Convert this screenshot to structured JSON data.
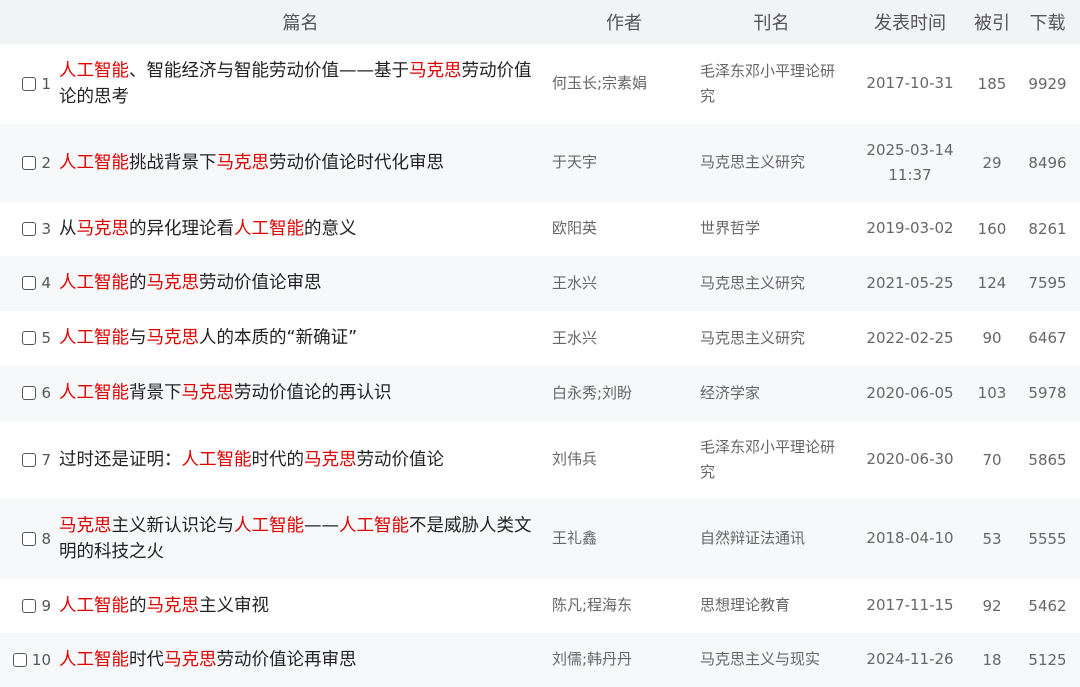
{
  "header": {
    "title": "篇名",
    "author": "作者",
    "journal": "刊名",
    "date": "发表时间",
    "cited": "被引",
    "downloads": "下载"
  },
  "rows": [
    {
      "index": "1",
      "title_parts": [
        [
          "hl",
          "人工智能"
        ],
        [
          "n",
          "、智能经济与智能劳动价值——基于"
        ],
        [
          "hl",
          "马克思"
        ],
        [
          "n",
          "劳动价值论的思考"
        ]
      ],
      "authors": "何玉长;宗素娟",
      "journal": "毛泽东邓小平理论研究",
      "date": "2017-10-31",
      "cited": "185",
      "downloads": "9929"
    },
    {
      "index": "2",
      "title_parts": [
        [
          "hl",
          "人工智能"
        ],
        [
          "n",
          "挑战背景下"
        ],
        [
          "hl",
          "马克思"
        ],
        [
          "n",
          "劳动价值论时代化审思"
        ]
      ],
      "authors": "于天宇",
      "journal": "马克思主义研究",
      "date": "2025-03-14 11:37",
      "cited": "29",
      "downloads": "8496"
    },
    {
      "index": "3",
      "title_parts": [
        [
          "n",
          "从"
        ],
        [
          "hl",
          "马克思"
        ],
        [
          "n",
          "的异化理论看"
        ],
        [
          "hl",
          "人工智能"
        ],
        [
          "n",
          "的意义"
        ]
      ],
      "authors": "欧阳英",
      "journal": "世界哲学",
      "date": "2019-03-02",
      "cited": "160",
      "downloads": "8261"
    },
    {
      "index": "4",
      "title_parts": [
        [
          "hl",
          "人工智能"
        ],
        [
          "n",
          "的"
        ],
        [
          "hl",
          "马克思"
        ],
        [
          "n",
          "劳动价值论审思"
        ]
      ],
      "authors": "王水兴",
      "journal": "马克思主义研究",
      "date": "2021-05-25",
      "cited": "124",
      "downloads": "7595"
    },
    {
      "index": "5",
      "title_parts": [
        [
          "hl",
          "人工智能"
        ],
        [
          "n",
          "与"
        ],
        [
          "hl",
          "马克思"
        ],
        [
          "n",
          "人的本质的“新确证”"
        ]
      ],
      "authors": "王水兴",
      "journal": "马克思主义研究",
      "date": "2022-02-25",
      "cited": "90",
      "downloads": "6467"
    },
    {
      "index": "6",
      "title_parts": [
        [
          "hl",
          "人工智能"
        ],
        [
          "n",
          "背景下"
        ],
        [
          "hl",
          "马克思"
        ],
        [
          "n",
          "劳动价值论的再认识"
        ]
      ],
      "authors": "白永秀;刘盼",
      "journal": "经济学家",
      "date": "2020-06-05",
      "cited": "103",
      "downloads": "5978"
    },
    {
      "index": "7",
      "title_parts": [
        [
          "n",
          "过时还是证明："
        ],
        [
          "hl",
          "人工智能"
        ],
        [
          "n",
          "时代的"
        ],
        [
          "hl",
          "马克思"
        ],
        [
          "n",
          "劳动价值论"
        ]
      ],
      "authors": "刘伟兵",
      "journal": "毛泽东邓小平理论研究",
      "date": "2020-06-30",
      "cited": "70",
      "downloads": "5865"
    },
    {
      "index": "8",
      "title_parts": [
        [
          "hl",
          "马克思"
        ],
        [
          "n",
          "主义新认识论与"
        ],
        [
          "hl",
          "人工智能"
        ],
        [
          "n",
          "——"
        ],
        [
          "hl",
          "人工智能"
        ],
        [
          "n",
          "不是威胁人类文明的科技之火"
        ]
      ],
      "authors": "王礼鑫",
      "journal": "自然辩证法通讯",
      "date": "2018-04-10",
      "cited": "53",
      "downloads": "5555"
    },
    {
      "index": "9",
      "title_parts": [
        [
          "hl",
          "人工智能"
        ],
        [
          "n",
          "的"
        ],
        [
          "hl",
          "马克思"
        ],
        [
          "n",
          "主义审视"
        ]
      ],
      "authors": "陈凡;程海东",
      "journal": "思想理论教育",
      "date": "2017-11-15",
      "cited": "92",
      "downloads": "5462"
    },
    {
      "index": "10",
      "title_parts": [
        [
          "hl",
          "人工智能"
        ],
        [
          "n",
          "时代"
        ],
        [
          "hl",
          "马克思"
        ],
        [
          "n",
          "劳动价值论再审思"
        ]
      ],
      "authors": "刘儒;韩丹丹",
      "journal": "马克思主义与现实",
      "date": "2024-11-26",
      "cited": "18",
      "downloads": "5125"
    }
  ],
  "colors": {
    "highlight": "#e00000",
    "header_bg": "#f2f3f5",
    "alt_row_bg": "#f7f8fa"
  }
}
